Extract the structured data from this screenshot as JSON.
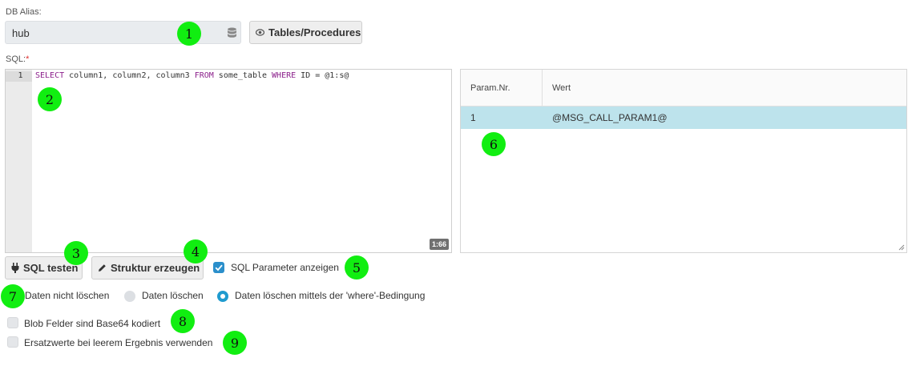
{
  "db_alias": {
    "label": "DB Alias:",
    "value": "hub",
    "icon": "database-icon",
    "tables_button": "Tables/Procedures"
  },
  "sql": {
    "label": "SQL:",
    "required_marker": "*",
    "line_number": "1",
    "code": {
      "kw_select": "SELECT",
      "columns": " column1, column2, column3 ",
      "kw_from": "FROM",
      "table": " some_table ",
      "kw_where": "WHERE",
      "condition": " ID = @1:s@"
    },
    "cursor_position": "1:66"
  },
  "params_table": {
    "headers": [
      "Param.Nr.",
      "Wert"
    ],
    "rows": [
      {
        "nr": "1",
        "wert": "@MSG_CALL_PARAM1@"
      }
    ]
  },
  "actions": {
    "test_sql": "SQL testen",
    "create_structure": "Struktur erzeugen",
    "show_params_label": "SQL Parameter anzeigen",
    "show_params_checked": true
  },
  "delete_mode": {
    "options": [
      {
        "label": "Daten nicht löschen",
        "selected": false
      },
      {
        "label": "Daten löschen",
        "selected": false
      },
      {
        "label": "Daten löschen mittels der 'where'-Bedingung",
        "selected": true
      }
    ]
  },
  "options": {
    "blob_base64": {
      "label": "Blob Felder sind Base64 kodiert",
      "checked": false
    },
    "substitute_empty": {
      "label": "Ersatzwerte bei leerem Ergebnis verwenden",
      "checked": false
    }
  },
  "badges": [
    "1",
    "2",
    "3",
    "4",
    "5",
    "6",
    "7",
    "8",
    "9"
  ],
  "colors": {
    "badge": "#11ee11",
    "selected_row": "#bde3ec",
    "accent": "#2b8fcb",
    "keyword": "#8b1f8b"
  }
}
